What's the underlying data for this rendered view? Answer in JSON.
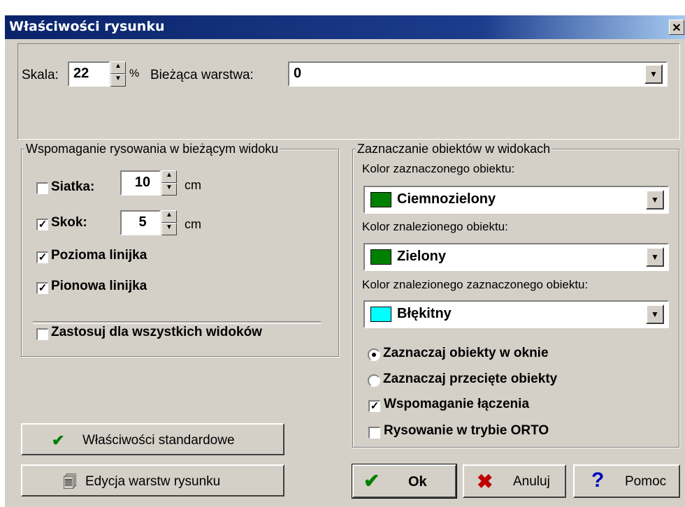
{
  "window": {
    "title": "Właściwości rysunku",
    "close_glyph": "✕"
  },
  "top": {
    "scale_label": "Skala:",
    "scale_value": "22",
    "percent": "%",
    "layer_label": "Bieżąca warstwa:",
    "layer_value": "0"
  },
  "assist": {
    "legend": "Wspomaganie rysowania w bieżącym widoku",
    "grid": {
      "label": "Siatka:",
      "checked": false,
      "value": "10",
      "unit": "cm"
    },
    "snap": {
      "label": "Skok:",
      "checked": true,
      "value": "5",
      "unit": "cm"
    },
    "hruler": {
      "label": "Pozioma linijka",
      "checked": true
    },
    "vruler": {
      "label": "Pionowa linijka",
      "checked": true
    },
    "apply_all": {
      "label": "Zastosuj dla wszystkich widoków",
      "checked": false
    }
  },
  "selection": {
    "legend": "Zaznaczanie obiektów w widokach",
    "selected_color_label": "Kolor zaznaczonego obiektu:",
    "selected_color": {
      "name": "Ciemnozielony",
      "hex": "#008000"
    },
    "found_color_label": "Kolor znalezionego obiektu:",
    "found_color": {
      "name": "Zielony",
      "hex": "#008000"
    },
    "found_selected_label": "Kolor znalezionego zaznaczonego obiektu:",
    "found_selected_color": {
      "name": "Błękitny",
      "hex": "#00ffff"
    },
    "radio_window": {
      "label": "Zaznaczaj obiekty w oknie",
      "selected": true
    },
    "radio_cross": {
      "label": "Zaznaczaj przecięte obiekty",
      "selected": false
    },
    "snap_connect": {
      "label": "Wspomaganie łączenia",
      "checked": true
    },
    "ortho": {
      "label": "Rysowanie w trybie ORTO",
      "checked": false
    }
  },
  "buttons": {
    "standard": "Właściwości standardowe",
    "layers": "Edycja warstw rysunku",
    "ok": "Ok",
    "cancel": "Anuluj",
    "help": "Pomoc"
  }
}
